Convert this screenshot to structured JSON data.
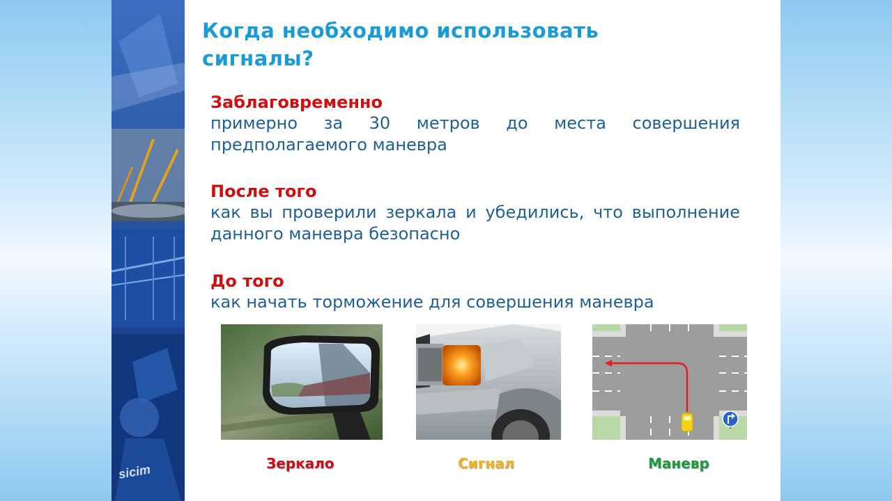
{
  "slide": {
    "title_line1": "Когда необходимо использовать",
    "title_line2": "сигналы?",
    "points": [
      {
        "heading": "Заблаговременно",
        "body": "примерно за 30 метров до места совершения предполагаемого маневра"
      },
      {
        "heading": "После того",
        "body": "как вы проверили зеркала и убедились, что выполнение данного маневра безопасно"
      },
      {
        "heading": "До того",
        "body": "как начать торможение для совершения маневра"
      }
    ],
    "images": [
      {
        "caption": "Зеркало",
        "caption_color": "#c8101a",
        "depicts": "side-mirror-photo"
      },
      {
        "caption": "Сигнал",
        "caption_color": "#f2b01e",
        "depicts": "turn-signal-photo"
      },
      {
        "caption": "Маневр",
        "caption_color": "#1f9a3a",
        "depicts": "intersection-maneuver-diagram"
      }
    ]
  },
  "sidebar": {
    "logo_text": "sicim"
  },
  "colors": {
    "title": "#1a9ad6",
    "heading": "#d01010",
    "body": "#1f5f99"
  }
}
